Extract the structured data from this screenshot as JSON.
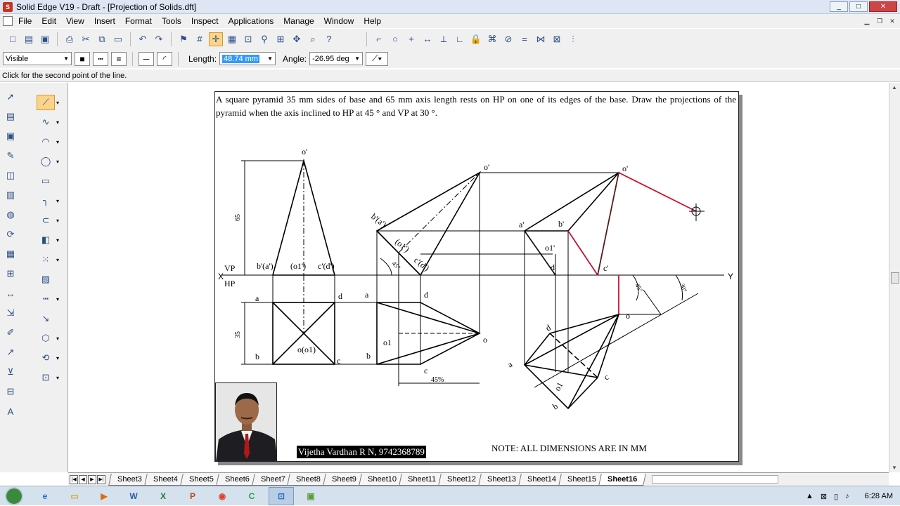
{
  "window": {
    "title": "Solid Edge V19 - Draft - [Projection of Solids.dft]",
    "min": "_",
    "max": "□",
    "close": "✕"
  },
  "menu": [
    "File",
    "Edit",
    "View",
    "Insert",
    "Format",
    "Tools",
    "Inspect",
    "Applications",
    "Manage",
    "Window",
    "Help"
  ],
  "ribbon2": {
    "style_value": "Visible",
    "length_label": "Length:",
    "length_value": "48.74 mm",
    "angle_label": "Angle:",
    "angle_value": "-26.95 deg"
  },
  "status": "Click for the second point of the line.",
  "problem": "A square pyramid 35 mm sides of base and 65 mm axis length rests on HP on one of its edges of the base. Draw the projections of the pyramid when the axis inclined to HP at 45 ° and VP at 30 °.",
  "labels": {
    "X": "X",
    "Y": "Y",
    "VP": "VP",
    "HP": "HP",
    "o_p": "o'",
    "bpap": "b'(a')",
    "o1p": "(o1')",
    "cpdp": "c'(d')",
    "dim65": "65",
    "dim35": "35",
    "a": "a",
    "d": "d",
    "b": "b",
    "c": "c",
    "oo1": "o(o1)",
    "a2": "a",
    "d2": "d",
    "b2": "b",
    "c2": "c",
    "o1b": "o1",
    "o2": "o",
    "o_p2": "o'",
    "bpap2": "b'(a')",
    "o1p2": "(o1')",
    "cpdp2": "c'(d')",
    "ang45": "45°",
    "dim45": "45%",
    "o_p3": "o'",
    "ap3": "a'",
    "bp3": "b'",
    "o1p3": "o1'",
    "dp3": "d'",
    "cp3": "c'",
    "ang45b": "45°",
    "ang30": "30°",
    "a3": "a",
    "b3": "b",
    "d3": "d",
    "c3": "c",
    "o3": "o",
    "o13": "o1"
  },
  "credit": "Vijetha Vardhan R N, 9742368789",
  "note": "NOTE: ALL DIMENSIONS ARE IN MM",
  "sheets": [
    "Sheet3",
    "Sheet4",
    "Sheet5",
    "Sheet6",
    "Sheet7",
    "Sheet8",
    "Sheet9",
    "Sheet10",
    "Sheet11",
    "Sheet12",
    "Sheet13",
    "Sheet14",
    "Sheet15",
    "Sheet16"
  ],
  "active_sheet": "Sheet16",
  "clock": "6:28 AM"
}
